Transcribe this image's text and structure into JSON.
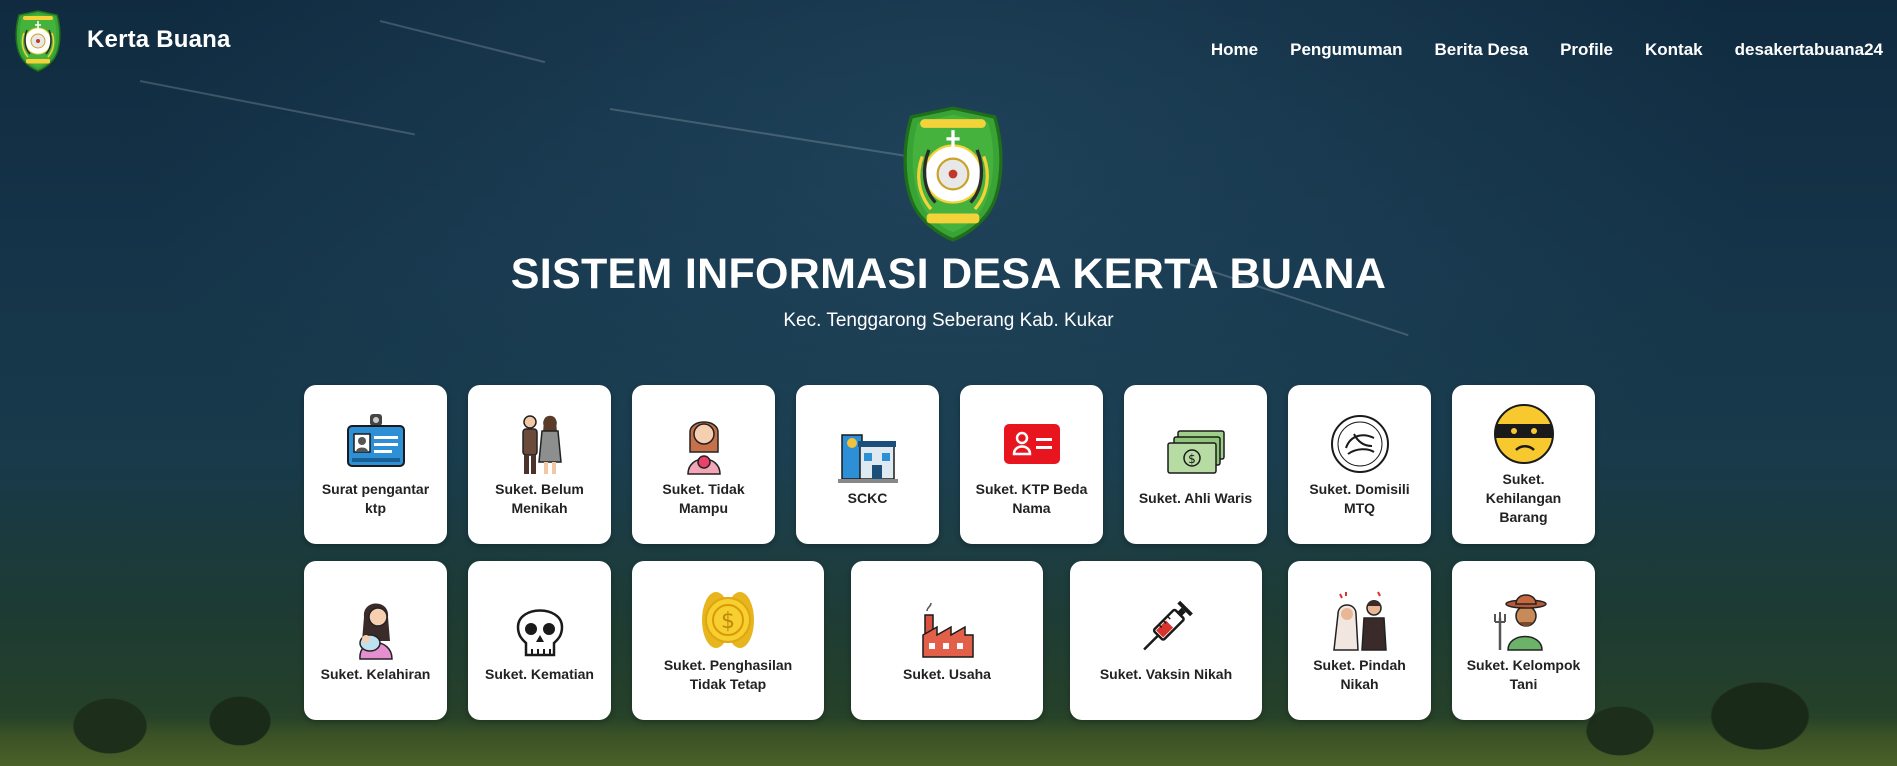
{
  "navbar": {
    "brand": "Kerta Buana",
    "links": [
      "Home",
      "Pengumuman",
      "Berita Desa",
      "Profile",
      "Kontak",
      "desakertabuana24"
    ]
  },
  "hero": {
    "title": "SISTEM INFORMASI DESA KERTA BUANA",
    "subtitle": "Kec. Tenggarong Seberang Kab. Kukar"
  },
  "services": [
    {
      "label": "Surat pengantar ktp",
      "icon": "id-card-icon"
    },
    {
      "label": "Suket. Belum Menikah",
      "icon": "couple-icon"
    },
    {
      "label": "Suket. Tidak Mampu",
      "icon": "woman-coin-icon"
    },
    {
      "label": "SCKC",
      "icon": "police-station-icon"
    },
    {
      "label": "Suket. KTP Beda Nama",
      "icon": "id-badge-icon"
    },
    {
      "label": "Suket. Ahli Waris",
      "icon": "money-stack-icon"
    },
    {
      "label": "Suket. Domisili MTQ",
      "icon": "quran-emblem-icon"
    },
    {
      "label": "Suket. Kehilangan Barang",
      "icon": "thief-face-icon"
    },
    {
      "label": "Suket. Kelahiran",
      "icon": "mother-baby-icon"
    },
    {
      "label": "Suket. Kematian",
      "icon": "skull-icon"
    },
    {
      "label": "Suket. Penghasilan Tidak Tetap",
      "icon": "coins-icon"
    },
    {
      "label": "Suket. Usaha",
      "icon": "factory-icon"
    },
    {
      "label": "Suket. Vaksin Nikah",
      "icon": "syringe-icon"
    },
    {
      "label": "Suket. Pindah Nikah",
      "icon": "wedding-couple-icon"
    },
    {
      "label": "Suket. Kelompok Tani",
      "icon": "farmer-icon"
    }
  ],
  "colors": {
    "card_bg": "#ffffff",
    "text": "#ffffff",
    "emblem_green": "#3aa335"
  }
}
